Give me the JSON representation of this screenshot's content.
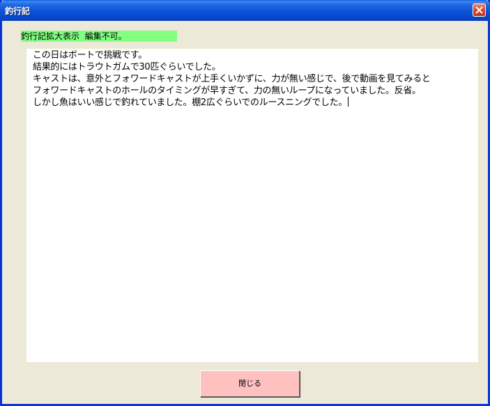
{
  "window": {
    "title": "釣行記",
    "accent_color": "#0a53d8",
    "close_icon": "close-icon"
  },
  "banner": {
    "text": "釣行記拡大表示  編集不可。",
    "color": "#80ff80"
  },
  "textbox": {
    "lines": [
      "この日はボートで挑戦です。",
      "結果的にはトラウトガムで30匹ぐらいでした。",
      "キャストは、意外とフォワードキャストが上手くいかずに、力が無い感じで、後で動画を見てみると",
      "フォワードキャストのホールのタイミングが早すぎて、力の無いループになっていました。反省。",
      "しかし魚はいい感じで釣れていました。棚2広ぐらいでのルースニングでした。"
    ]
  },
  "footer": {
    "close_label": "閉じる",
    "close_color": "#ffc0c0"
  }
}
